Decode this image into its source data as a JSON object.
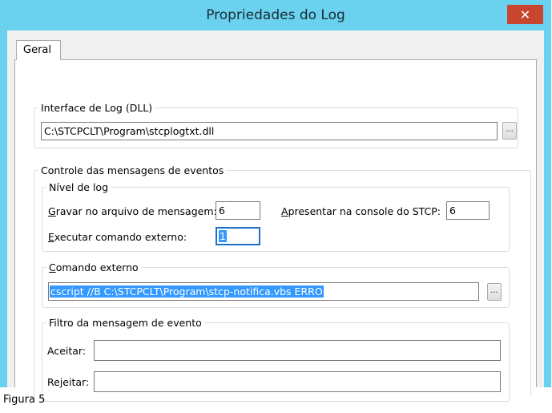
{
  "window": {
    "title": "Propriedades do Log",
    "close_icon": "x-close-icon",
    "close_glyph": "✕"
  },
  "tabs": [
    {
      "label": "Geral",
      "selected": true
    }
  ],
  "log_interface": {
    "legend": "Interface de Log (DLL)",
    "path_value": "C:\\STCPCLT\\Program\\stcplogtxt.dll",
    "browse_label": "..."
  },
  "event_control": {
    "legend": "Controle das mensagens de eventos",
    "log_level": {
      "legend": "Nível de log",
      "write_file_label_accel": "G",
      "write_file_label_rest": "ravar no arquivo de mensagem:",
      "write_file_value": "6",
      "console_label_accel": "A",
      "console_label_rest": "presentar na console do STCP:",
      "console_value": "6",
      "exec_label_accel": "E",
      "exec_label_rest": "xecutar comando externo:",
      "exec_value": "1"
    },
    "external_command": {
      "legend_accel": "C",
      "legend_rest": "omando externo",
      "value": "cscript //B C:\\STCPCLT\\Program\\stcp-notifica.vbs ERRO",
      "browse_label": "..."
    },
    "filter": {
      "legend": "Filtro da mensagem de evento",
      "accept_label": "Aceitar:",
      "accept_value": "",
      "reject_label": "Rejeitar:",
      "reject_value": ""
    }
  },
  "caption": "Figura 5",
  "colors": {
    "titlebar": "#6ad2ef",
    "close_button": "#c9452e",
    "selection": "#3399ff"
  }
}
